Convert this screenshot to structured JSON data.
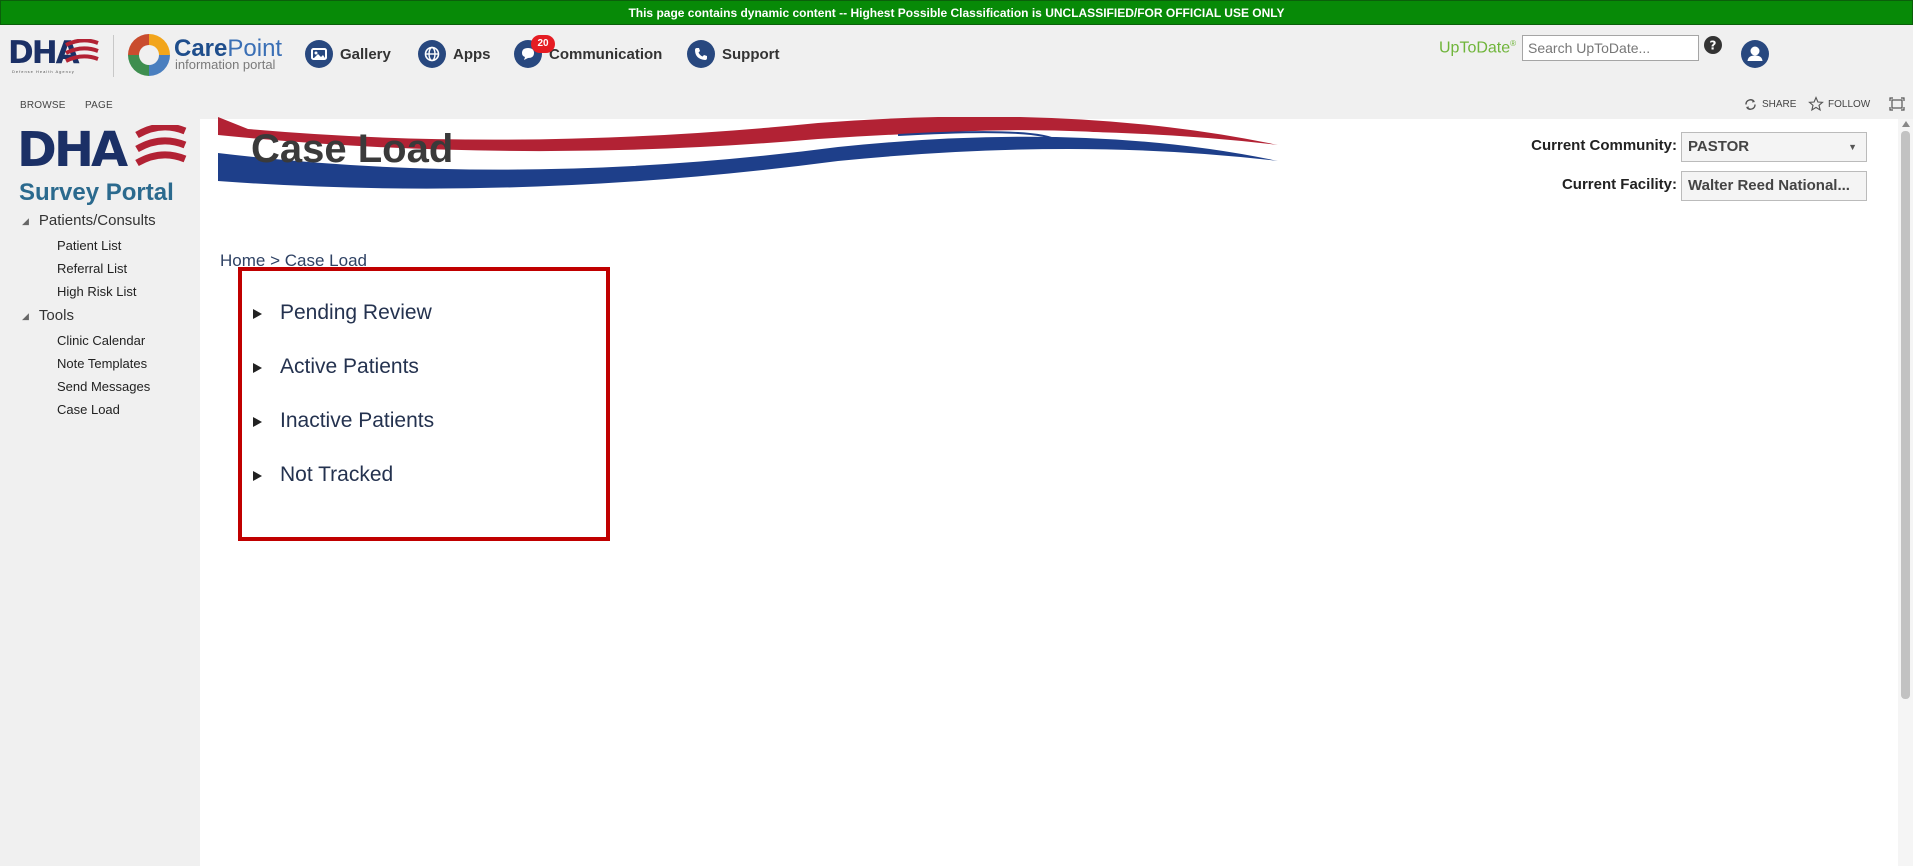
{
  "banner": {
    "text": "This page contains dynamic content -- Highest Possible Classification is UNCLASSIFIED/FOR OFFICIAL USE ONLY"
  },
  "brand": {
    "dha_logo": "DHA",
    "dha_sub": "Defense Health Agency",
    "carepoint_care": "Care",
    "carepoint_point": "Point",
    "carepoint_sub": "information portal"
  },
  "topnav": {
    "items": [
      {
        "label": "Gallery",
        "icon": "gallery-icon"
      },
      {
        "label": "Apps",
        "icon": "globe-icon"
      },
      {
        "label": "Communication",
        "icon": "chat-icon",
        "badge": "20"
      },
      {
        "label": "Support",
        "icon": "phone-icon"
      }
    ],
    "uptodate_label": "UpToDate",
    "uptodate_mark": "®",
    "search_placeholder": "Search UpToDate..."
  },
  "ribbon": {
    "tabs": [
      "BROWSE",
      "PAGE"
    ],
    "share_label": "SHARE",
    "follow_label": "FOLLOW"
  },
  "sidebar": {
    "logo_text": "DHA",
    "portal_name": "Survey Portal",
    "groups": [
      {
        "label": "Patients/Consults",
        "items": [
          "Patient List",
          "Referral List",
          "High Risk List"
        ]
      },
      {
        "label": "Tools",
        "items": [
          "Clinic Calendar",
          "Note Templates",
          "Send Messages",
          "Case Load"
        ]
      }
    ]
  },
  "main": {
    "title": "Case Load",
    "community_label": "Current Community:",
    "community_value": "PASTOR",
    "facility_label": "Current Facility:",
    "facility_value": "Walter Reed National...",
    "breadcrumb": {
      "home": "Home",
      "separator": ">",
      "current": "Case Load"
    },
    "sections": [
      "Pending Review",
      "Active Patients",
      "Inactive Patients",
      "Not Tracked"
    ]
  },
  "colors": {
    "banner_green": "#078a07",
    "nav_icon_blue": "#28487f",
    "highlight_red": "#c00000",
    "uptodate_green": "#6fb53a"
  }
}
